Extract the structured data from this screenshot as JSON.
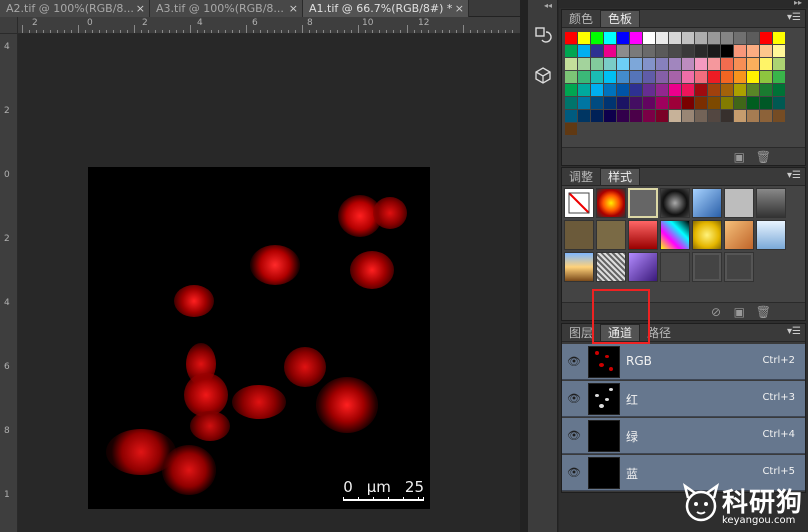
{
  "tabs": [
    {
      "label": "A2.tif @ 100%(RGB/8...",
      "close": "×"
    },
    {
      "label": "A3.tif @ 100%(RGB/8...",
      "close": "×"
    },
    {
      "label": "A1.tif @ 66.7%(RGB/8#) *",
      "close": "×"
    }
  ],
  "ruler": {
    "h_labels": [
      "2",
      "0",
      "2",
      "4",
      "6",
      "8",
      "10",
      "12"
    ],
    "v_labels": [
      "4",
      "2",
      "0",
      "2",
      "4",
      "6",
      "8",
      "1"
    ]
  },
  "image": {
    "scale_left": "0",
    "scale_mid": "μm",
    "scale_right": "25"
  },
  "panel_swatches": {
    "tabs": [
      "颜色",
      "色板"
    ],
    "active": "色板",
    "colors": [
      "#ff0000",
      "#ffff00",
      "#00ff00",
      "#00ffff",
      "#0000ff",
      "#ff00ff",
      "#ffffff",
      "#ebebeb",
      "#d6d6d6",
      "#c2c2c2",
      "#adadad",
      "#999999",
      "#858585",
      "#707070",
      "#5c5c5c",
      "#ff0000",
      "#ffff00",
      "#00a651",
      "#00aeef",
      "#2e3192",
      "#ec008c",
      "#8c8c8c",
      "#7a7a7a",
      "#6a6a6a",
      "#5a5a5a",
      "#4a4a4a",
      "#3a3a3a",
      "#2a2a2a",
      "#1a1a1a",
      "#000000",
      "#f7977a",
      "#fbad82",
      "#fdc68c",
      "#fff799",
      "#c4df9b",
      "#a3d39c",
      "#82ca9c",
      "#7accc8",
      "#6dcff6",
      "#7da7d9",
      "#8393ca",
      "#8781bd",
      "#a186be",
      "#bd8cbf",
      "#f49ac1",
      "#f5989d",
      "#f26c4f",
      "#f68e55",
      "#fbaf5c",
      "#fff467",
      "#acd372",
      "#7cc576",
      "#3bb878",
      "#1abbb4",
      "#00bff3",
      "#438ccb",
      "#5574b9",
      "#605ca8",
      "#855fa8",
      "#a763a9",
      "#ef6ea8",
      "#f16d7e",
      "#ed1c24",
      "#f26522",
      "#f7941d",
      "#fff200",
      "#8dc63f",
      "#39b54a",
      "#00a651",
      "#00a99d",
      "#00aeef",
      "#0072bc",
      "#0054a6",
      "#2e3192",
      "#662d91",
      "#92278f",
      "#ec008c",
      "#ed145b",
      "#9e0b0f",
      "#a0410d",
      "#a3620a",
      "#aba000",
      "#598527",
      "#1a7b30",
      "#007236",
      "#00746b",
      "#0076a3",
      "#004b80",
      "#003471",
      "#1b1464",
      "#440e62",
      "#630460",
      "#9e005d",
      "#9e0039",
      "#790000",
      "#7b2e00",
      "#7d4900",
      "#827b00",
      "#406618",
      "#005e20",
      "#005826",
      "#005952",
      "#005b7f",
      "#003663",
      "#002157",
      "#0d004c",
      "#32004b",
      "#4b0049",
      "#7b0046",
      "#7a0026",
      "#c7b299",
      "#998675",
      "#736357",
      "#534741",
      "#37302d",
      "#c69c6d",
      "#a67c52",
      "#8c6239",
      "#754c24",
      "#603913"
    ]
  },
  "panel_styles": {
    "tabs": [
      "调整",
      "样式"
    ],
    "active": "样式"
  },
  "panel_channels": {
    "tabs": [
      "图层",
      "通道",
      "路径"
    ],
    "active": "通道",
    "rows": [
      {
        "name": "RGB",
        "shortcut": "Ctrl+2"
      },
      {
        "name": "红",
        "shortcut": "Ctrl+3"
      },
      {
        "name": "绿",
        "shortcut": "Ctrl+4"
      },
      {
        "name": "蓝",
        "shortcut": "Ctrl+5"
      }
    ]
  },
  "logo": {
    "name": "科研狗",
    "url": "keyangou.com"
  },
  "icons": [
    "close-icon",
    "history-icon",
    "3d-icon",
    "panel-menu-icon",
    "new-swatch-icon",
    "trash-icon",
    "no-entry-icon",
    "eye-icon",
    "collapse-icon"
  ],
  "colors": {
    "accent_selected": "#66778e",
    "highlight_box": "#e22222",
    "fluorescence": "#ff1a1a"
  }
}
